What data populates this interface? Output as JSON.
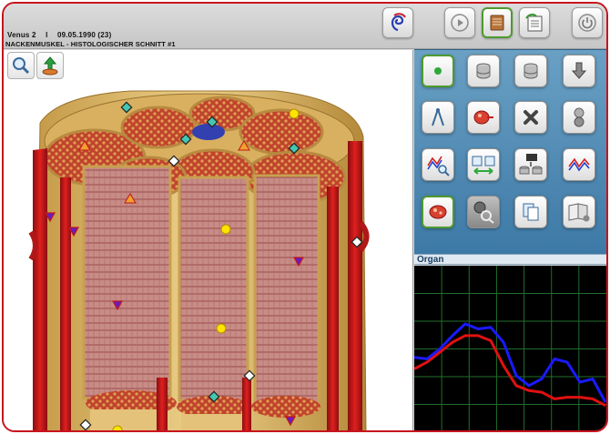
{
  "window": {
    "app_name": "Venus 2",
    "separator": "l",
    "date": "09.05.1990 (23)",
    "subtitle": "NACKENMUSKEL - HISTOLOGISCHER SCHNITT #1"
  },
  "panel": {
    "organ_label": "Organ"
  },
  "colors": {
    "frame_red": "#c8141e",
    "panel_blue": "#4a86b2",
    "button_green": "#4e9a2e",
    "graph_blue": "#1a1aff",
    "graph_red": "#e01010",
    "graph_grid": "#1f6e2a"
  },
  "icons": {
    "toolbar": [
      "spiral-logo-icon",
      "play-icon",
      "book-icon",
      "notepad-icon",
      "power-icon"
    ],
    "viewer_tools": [
      "zoom-icon",
      "upload-icon"
    ],
    "panel": [
      "target-dot-icon",
      "database-icon",
      "database-icon",
      "pointer-icon",
      "compass-icon",
      "tissue-sample-icon",
      "close-icon",
      "toggle-icon",
      "graph-zoom-icon",
      "compare-icon",
      "transfer-icon",
      "graph-icon",
      "tissue-icon",
      "scan-icon",
      "copy-icon",
      "book-icon"
    ]
  },
  "graph_data": {
    "blue": [
      0.55,
      0.56,
      0.5,
      0.42,
      0.35,
      0.38,
      0.37,
      0.46,
      0.66,
      0.72,
      0.68,
      0.56,
      0.58,
      0.7,
      0.68,
      0.82
    ],
    "red": [
      0.62,
      0.58,
      0.52,
      0.46,
      0.42,
      0.42,
      0.45,
      0.6,
      0.72,
      0.75,
      0.76,
      0.8,
      0.79,
      0.79,
      0.8,
      0.84
    ]
  }
}
